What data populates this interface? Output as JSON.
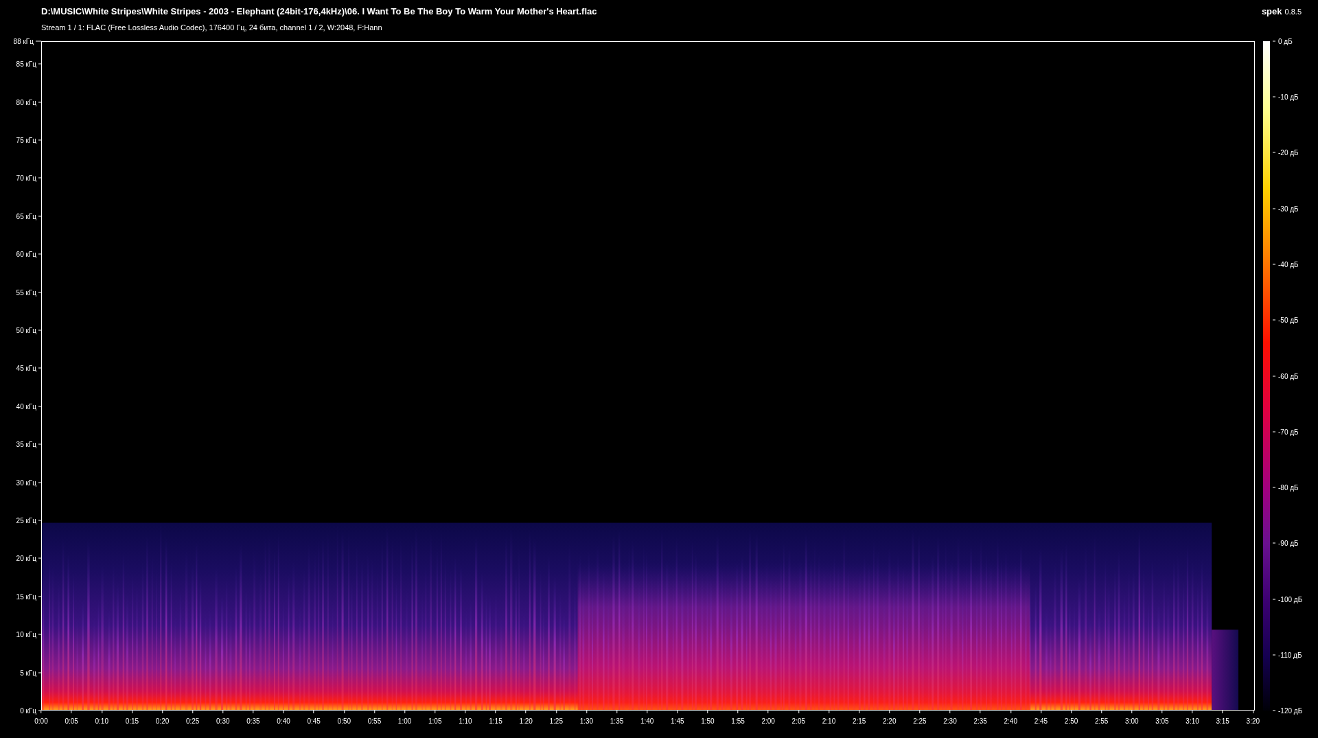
{
  "header": {
    "title": "D:\\MUSIC\\White Stripes\\White Stripes - 2003 - Elephant (24bit-176,4kHz)\\06. I Want To Be The Boy To Warm Your Mother's Heart.flac",
    "stream_info": "Stream 1 / 1: FLAC (Free Lossless Audio Codec), 176400 Гц, 24 бита, channel 1 / 2, W:2048, F:Hann",
    "app_name": "spek",
    "app_version": "0.8.5"
  },
  "frequency_axis": {
    "labels": [
      "88 кГц",
      "85 кГц",
      "80 кГц",
      "75 кГц",
      "70 кГц",
      "65 кГц",
      "60 кГц",
      "55 кГц",
      "50 кГц",
      "45 кГц",
      "40 кГц",
      "35 кГц",
      "30 кГц",
      "25 кГц",
      "20 кГц",
      "15 кГц",
      "10 кГц",
      "5 кГц",
      "0 кГц"
    ]
  },
  "time_axis": {
    "labels": [
      "0:00",
      "0:05",
      "0:10",
      "0:15",
      "0:20",
      "0:25",
      "0:30",
      "0:35",
      "0:40",
      "0:45",
      "0:50",
      "0:55",
      "1:00",
      "1:05",
      "1:10",
      "1:15",
      "1:20",
      "1:25",
      "1:30",
      "1:35",
      "1:40",
      "1:45",
      "1:50",
      "1:55",
      "2:00",
      "2:05",
      "2:10",
      "2:15",
      "2:20",
      "2:25",
      "2:30",
      "2:35",
      "2:40",
      "2:45",
      "2:50",
      "2:55",
      "3:00",
      "3:05",
      "3:10",
      "3:15",
      "3:20"
    ]
  },
  "colorbar": {
    "labels": [
      "0 дБ",
      "-10 дБ",
      "-20 дБ",
      "-30 дБ",
      "-40 дБ",
      "-50 дБ",
      "-60 дБ",
      "-70 дБ",
      "-80 дБ",
      "-90 дБ",
      "-100 дБ",
      "-110 дБ",
      "-120 дБ"
    ]
  }
}
